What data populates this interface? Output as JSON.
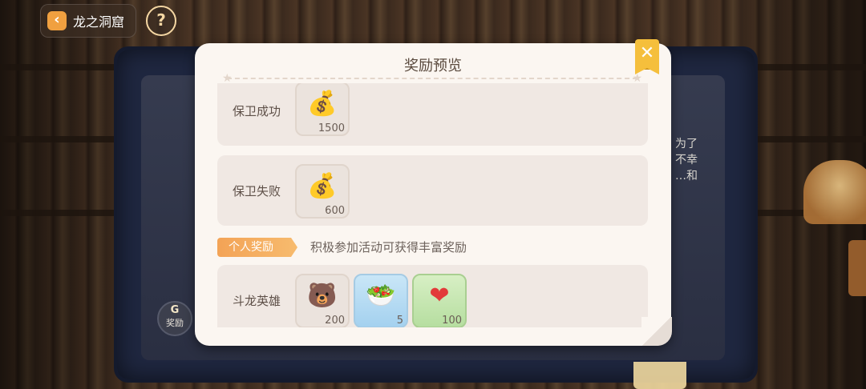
{
  "nav": {
    "back_label": "龙之洞窟",
    "help_label": "?"
  },
  "background": {
    "side_text": [
      "为了",
      "不幸",
      "…和"
    ],
    "reward_button_label": "奖励"
  },
  "modal": {
    "title": "奖励预览",
    "close_label": "✕",
    "rows": [
      {
        "label": "保卫成功",
        "items": [
          {
            "name": "gold-coin-bag",
            "icon": "money-bag-icon",
            "quantity": "1500",
            "style": "plain"
          }
        ]
      },
      {
        "label": "保卫失败",
        "items": [
          {
            "name": "gold-coin-bag",
            "icon": "money-bag-icon",
            "quantity": "600",
            "style": "plain"
          }
        ]
      }
    ],
    "section": {
      "tag": "个人奖励",
      "description": "积极参加活动可获得丰富奖励"
    },
    "personal_rows": [
      {
        "label": "斗龙英雄",
        "items": [
          {
            "name": "bear-badge",
            "icon": "bear-badge-icon",
            "quantity": "200",
            "style": "plain"
          },
          {
            "name": "food-plate",
            "icon": "food-plate-icon",
            "quantity": "5",
            "style": "blue"
          },
          {
            "name": "heart",
            "icon": "heart-icon",
            "quantity": "100",
            "style": "green"
          }
        ]
      }
    ]
  },
  "colors": {
    "modal_bg": "#fbf6f1",
    "row_bg": "#f0e8e3",
    "tag_orange": "#f3a356",
    "close_yellow": "#f5bf3c"
  }
}
